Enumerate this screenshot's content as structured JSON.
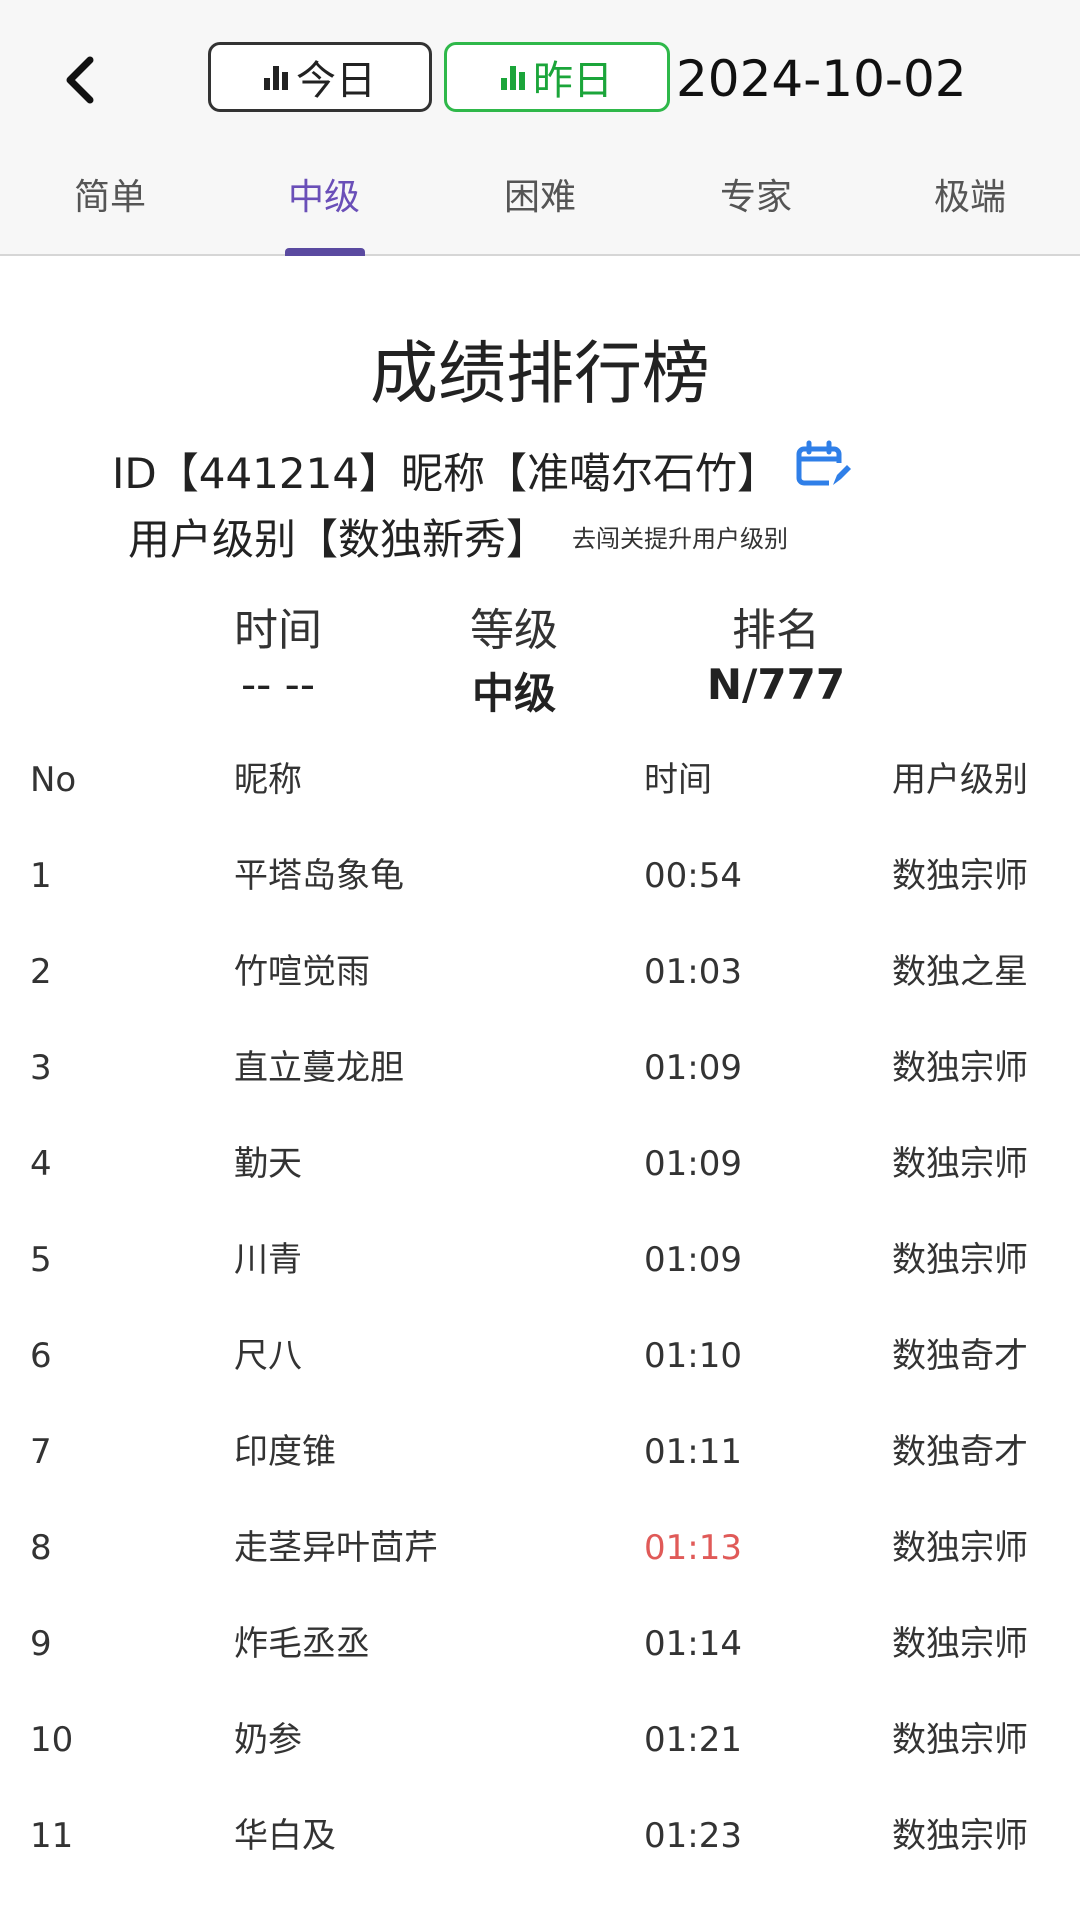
{
  "header": {
    "back_icon": "chevron-left-icon",
    "today_label": "今日",
    "yesterday_label": "昨日",
    "date": "2024-10-02",
    "colors": {
      "yesterday_accent": "#2fb84a",
      "active_tab": "#6a4fb8"
    }
  },
  "tabs": [
    {
      "label": "简单"
    },
    {
      "label": "中级",
      "active": true
    },
    {
      "label": "困难"
    },
    {
      "label": "专家"
    },
    {
      "label": "极端"
    }
  ],
  "page": {
    "title": "成绩排行榜",
    "id_line": "ID【441214】昵称【准噶尔石竹】",
    "edit_icon": "calendar-edit-icon",
    "user_level_line": "用户级别【数独新秀】",
    "upgrade_hint": "去闯关提升用户级别"
  },
  "stats": {
    "time_label": "时间",
    "time_value": "-- --",
    "level_label": "等级",
    "level_value": "中级",
    "rank_label": "排名",
    "rank_value": "N/777"
  },
  "table": {
    "headers": {
      "no": "No",
      "name": "昵称",
      "time": "时间",
      "level": "用户级别"
    },
    "rows": [
      {
        "no": "1",
        "name": "平塔岛象龟",
        "time": "00:54",
        "level": "数独宗师"
      },
      {
        "no": "2",
        "name": "竹喧觉雨",
        "time": "01:03",
        "level": "数独之星"
      },
      {
        "no": "3",
        "name": "直立蔓龙胆",
        "time": "01:09",
        "level": "数独宗师"
      },
      {
        "no": "4",
        "name": "勤天",
        "time": "01:09",
        "level": "数独宗师"
      },
      {
        "no": "5",
        "name": "川青",
        "time": "01:09",
        "level": "数独宗师"
      },
      {
        "no": "6",
        "name": "尺八",
        "time": "01:10",
        "level": "数独奇才"
      },
      {
        "no": "7",
        "name": "印度锥",
        "time": "01:11",
        "level": "数独奇才"
      },
      {
        "no": "8",
        "name": "走茎异叶茴芹",
        "time": "01:13",
        "level": "数独宗师",
        "highlight": true
      },
      {
        "no": "9",
        "name": "炸毛丞丞",
        "time": "01:14",
        "level": "数独宗师"
      },
      {
        "no": "10",
        "name": "奶参",
        "time": "01:21",
        "level": "数独宗师"
      },
      {
        "no": "11",
        "name": "华白及",
        "time": "01:23",
        "level": "数独宗师"
      }
    ]
  }
}
